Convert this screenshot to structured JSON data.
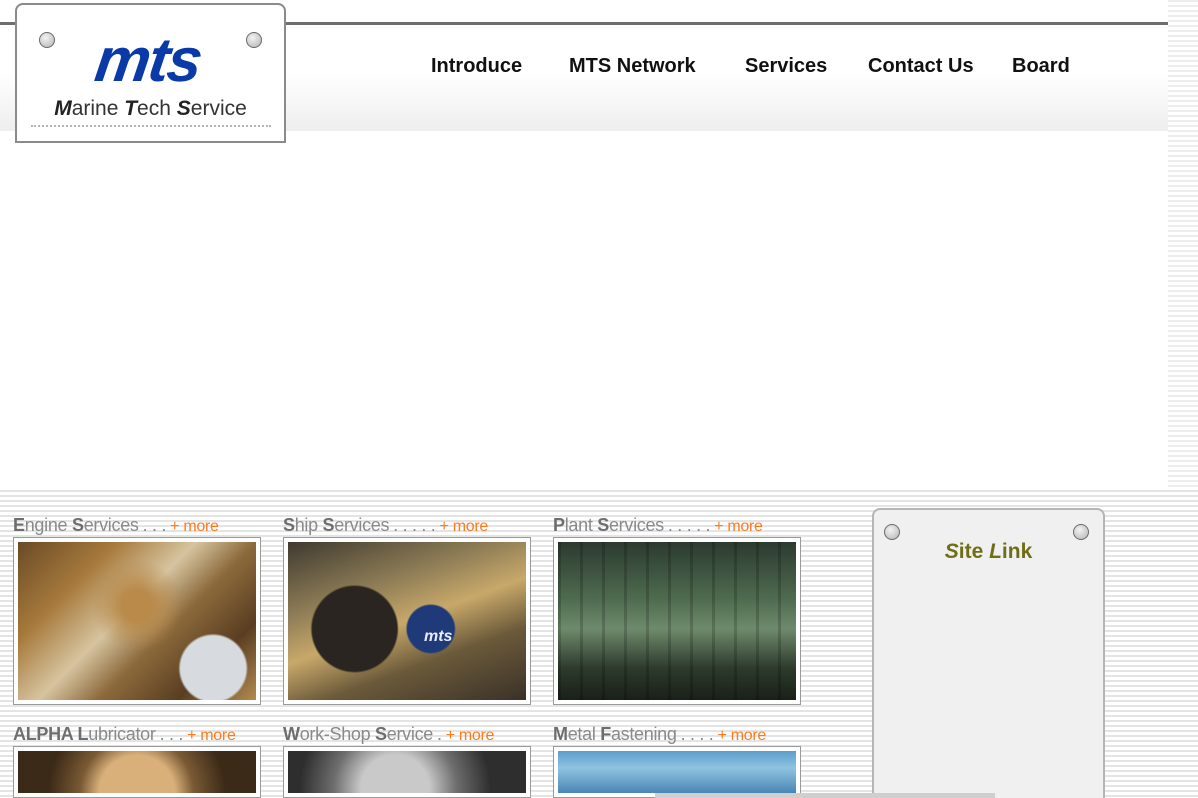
{
  "brand": {
    "logo_text": "mts",
    "tagline_parts": [
      {
        "cap": "M",
        "rest": "arine "
      },
      {
        "cap": "T",
        "rest": "ech "
      },
      {
        "cap": "S",
        "rest": "ervice"
      }
    ],
    "accent_color": "#0a3aa8"
  },
  "nav": {
    "items": [
      {
        "label": "Introduce"
      },
      {
        "label": "MTS Network"
      },
      {
        "label": "Services"
      },
      {
        "label": "Contact Us"
      },
      {
        "label": "Board"
      }
    ]
  },
  "services": {
    "more_label": "+ more",
    "more_color": "#ff7a1a",
    "items": [
      {
        "first": "E",
        "rest": "ngine ",
        "first2": "S",
        "rest2": "ervices",
        "dots": ". . .",
        "photo": "engine-photo"
      },
      {
        "first": "S",
        "rest": "hip ",
        "first2": "S",
        "rest2": "ervices",
        "dots": ". . . . .",
        "photo": "ship-photo"
      },
      {
        "first": "P",
        "rest": "lant ",
        "first2": "S",
        "rest2": "ervices",
        "dots": ". . . . .",
        "photo": "plant-photo"
      },
      {
        "first": "ALPHA ",
        "rest": "",
        "first2": "L",
        "rest2": "ubricator",
        "dots": ". . .",
        "photo": "alpha-photo"
      },
      {
        "first": "W",
        "rest": "ork-Shop ",
        "first2": "S",
        "rest2": "ervice",
        "dots": ".",
        "photo": "workshop-photo"
      },
      {
        "first": "M",
        "rest": "etal ",
        "first2": "F",
        "rest2": "astening",
        "dots": ". . . .",
        "photo": "metal-photo"
      }
    ]
  },
  "sitelink": {
    "title_parts": [
      {
        "cap": "S",
        "rest": "ite "
      },
      {
        "cap": "L",
        "rest": "ink"
      }
    ],
    "title_color": "#6f6e18"
  }
}
